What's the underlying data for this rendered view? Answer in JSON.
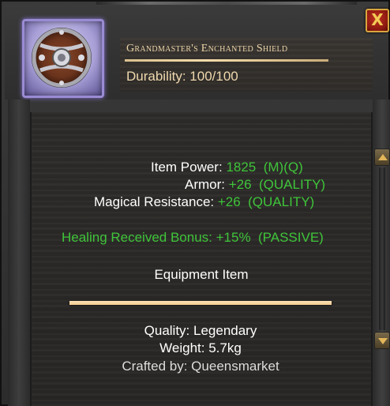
{
  "item": {
    "name": "Grandmaster's Enchanted Shield",
    "durability": "Durability: 100/100",
    "icon": "round-shield-icon",
    "rarity_color": "#9a8bd4"
  },
  "stats": [
    {
      "label": "Item Power:",
      "value": "1825  (M)(Q)"
    },
    {
      "label": "Armor:",
      "value": "+26  (QUALITY)"
    },
    {
      "label": "Magical Resistance:",
      "value": "+26  (QUALITY)"
    }
  ],
  "passive": "Healing Received Bonus: +15%  (PASSIVE)",
  "category": "Equipment Item",
  "footer": {
    "quality": "Quality: Legendary",
    "weight": "Weight: 5.7kg",
    "crafted": "Crafted by: Queensmarket"
  },
  "controls": {
    "close_label": "X"
  },
  "colors": {
    "stat_value": "#3fc53a",
    "label": "#ffffff",
    "title": "#ecd5a8"
  }
}
